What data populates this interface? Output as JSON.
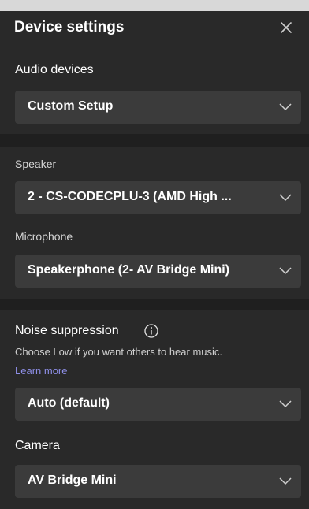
{
  "dialog": {
    "title": "Device settings"
  },
  "audio": {
    "label": "Audio devices",
    "value": "Custom Setup"
  },
  "speaker": {
    "label": "Speaker",
    "value": "2 - CS-CODECPLU-3 (AMD High ..."
  },
  "microphone": {
    "label": "Microphone",
    "value": "Speakerphone (2- AV Bridge Mini)"
  },
  "noise": {
    "label": "Noise suppression",
    "hint": "Choose Low if you want others to hear music.",
    "link": "Learn more",
    "value": "Auto (default)"
  },
  "camera": {
    "label": "Camera",
    "value": "AV Bridge Mini"
  },
  "icons": {
    "close": "close-icon",
    "chevron": "chevron-down-icon",
    "info": "info-icon"
  },
  "colors": {
    "panel_bg": "#292929",
    "dropdown_bg": "#3b3b3b",
    "link": "#8e8fe8"
  }
}
